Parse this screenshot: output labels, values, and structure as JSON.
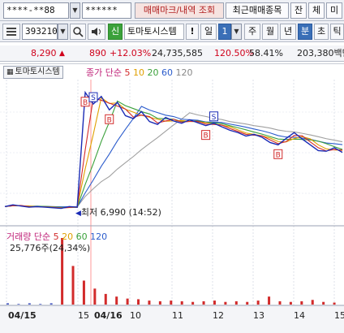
{
  "account": {
    "number": "****-**88",
    "password": "******"
  },
  "tabs": {
    "trade_mark": "매매마크/내역 조회",
    "recent": "최근매매종목",
    "balance": "잔",
    "order": "체",
    "unfilled": "미"
  },
  "toolbar": {
    "code": "393210",
    "credit_badge": "신",
    "stock_name": "토마토시스템",
    "alert": "!",
    "periods": [
      "일",
      "1",
      "주",
      "월",
      "년",
      "분",
      "초",
      "틱"
    ],
    "active_period": "분",
    "minute_value": "1"
  },
  "quote": {
    "price": "8,290",
    "change": "890",
    "change_pct": "+12.03%",
    "volume": "24,735,585",
    "vol_ratio": "120.50%",
    "turnover": "58.41%",
    "amount": "203,380백만"
  },
  "chart_data": [
    {
      "type": "line",
      "chart_title": "토마토시스템",
      "legend": {
        "type": "종가 단순",
        "periods": [
          "5",
          "10",
          "20",
          "60",
          "120"
        ],
        "colors": [
          "#d22b2b",
          "#e0a000",
          "#3ba13b",
          "#2b5ccc",
          "#a0a0a0"
        ]
      },
      "annotation_low": "최저 6,990 (14:52)",
      "x_labels": [
        "04/15",
        "15",
        "04/16",
        "10",
        "11",
        "12",
        "13",
        "14",
        "15"
      ],
      "trade_marks": [
        "B",
        "S",
        "B",
        "B",
        "S",
        "B"
      ],
      "series": [
        {
          "name": "price",
          "values": [
            6990,
            7020,
            7000,
            6980,
            6990,
            6980,
            6970,
            6960,
            6990,
            6980,
            8950,
            8750,
            8880,
            8650,
            8780,
            8550,
            8500,
            8620,
            8450,
            8400,
            8520,
            8460,
            8420,
            8480,
            8430,
            8380,
            8420,
            8360,
            8300,
            8260,
            8200,
            8230,
            8180,
            8090,
            8050,
            8160,
            8260,
            8150,
            8050,
            7950,
            7940,
            8000,
            7920
          ]
        }
      ]
    },
    {
      "type": "bar",
      "chart_title": "거래량",
      "legend": {
        "type": "단순",
        "periods": [
          "5",
          "20",
          "60",
          "120"
        ],
        "colors": [
          "#d22b2b",
          "#e0a000",
          "#3ba13b",
          "#2b5ccc"
        ]
      },
      "last_volume": "25,776주(24,34%)",
      "values": [
        0.02,
        0.01,
        0.02,
        0.01,
        0.02,
        1.0,
        0.58,
        0.36,
        0.24,
        0.16,
        0.12,
        0.09,
        0.08,
        0.06,
        0.05,
        0.06,
        0.05,
        0.04,
        0.05,
        0.06,
        0.04,
        0.05,
        0.04,
        0.06,
        0.12,
        0.05,
        0.04,
        0.05,
        0.07,
        0.04,
        0.03
      ]
    }
  ]
}
